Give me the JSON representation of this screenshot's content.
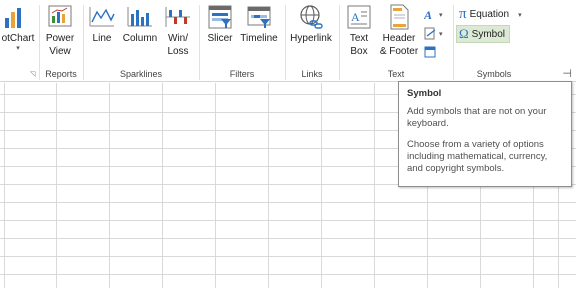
{
  "ribbon": {
    "buttons": {
      "pivotchart": {
        "label": "otChart",
        "caret": "▾"
      },
      "powerview": {
        "line1": "Power",
        "line2": "View"
      },
      "line": {
        "label": "Line"
      },
      "column": {
        "label": "Column"
      },
      "winloss": {
        "line1": "Win/",
        "line2": "Loss"
      },
      "slicer": {
        "label": "Slicer"
      },
      "timeline": {
        "label": "Timeline"
      },
      "hyperlink": {
        "label": "Hyperlink"
      },
      "textbox": {
        "line1": "Text",
        "line2": "Box"
      },
      "headerfooter": {
        "line1": "Header",
        "line2": "& Footer"
      },
      "equation": {
        "label": "Equation",
        "glyph": "π",
        "caret": "▾"
      },
      "symbol": {
        "label": "Symbol",
        "glyph": "Ω"
      }
    },
    "groups": {
      "reports": "Reports",
      "sparklines": "Sparklines",
      "filters": "Filters",
      "links": "Links",
      "text": "Text",
      "symbols": "Symbols"
    },
    "colors": {
      "accent_blue": "#2b72c2",
      "green": "#3e8d3b",
      "active_bg": "#dbe9d5"
    }
  },
  "tooltip": {
    "title": "Symbol",
    "p1": "Add symbols that are not on your keyboard.",
    "p2": "Choose from a variety of options including mathematical, currency, and copyright symbols."
  }
}
